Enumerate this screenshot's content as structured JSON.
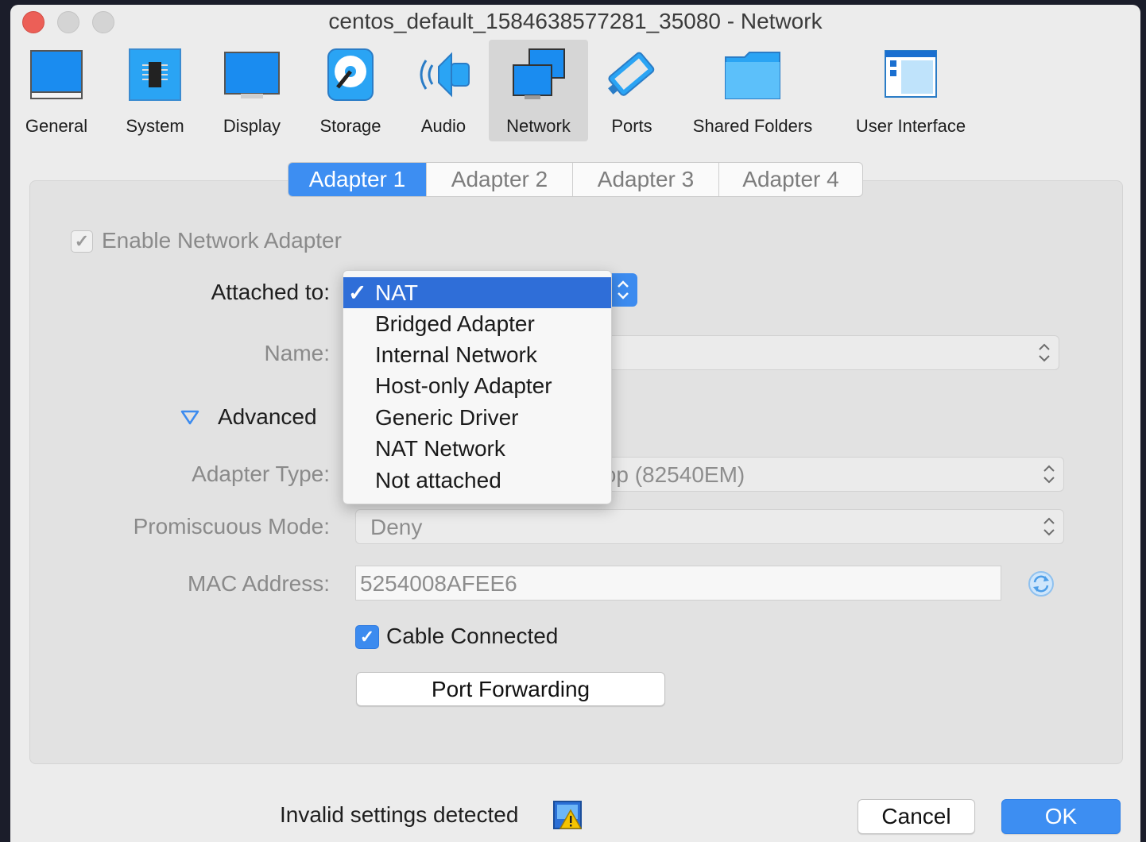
{
  "window": {
    "title": "centos_default_1584638577281_35080 - Network"
  },
  "toolbar": {
    "items": [
      {
        "label": "General",
        "icon": "general-icon"
      },
      {
        "label": "System",
        "icon": "chip-icon"
      },
      {
        "label": "Display",
        "icon": "monitor-icon"
      },
      {
        "label": "Storage",
        "icon": "disk-icon"
      },
      {
        "label": "Audio",
        "icon": "speaker-icon"
      },
      {
        "label": "Network",
        "icon": "network-icon"
      },
      {
        "label": "Ports",
        "icon": "serial-port-icon"
      },
      {
        "label": "Shared Folders",
        "icon": "folder-icon"
      },
      {
        "label": "User Interface",
        "icon": "user-interface-icon"
      }
    ],
    "active": "Network"
  },
  "tabs": {
    "items": [
      "Adapter 1",
      "Adapter 2",
      "Adapter 3",
      "Adapter 4"
    ],
    "active": "Adapter 1"
  },
  "adapter": {
    "enable_label": "Enable Network Adapter",
    "enabled": true,
    "attached_label": "Attached to:",
    "name_label": "Name:",
    "advanced_label": "Advanced",
    "adapter_type_label": "Adapter Type:",
    "adapter_type_value": "ktop (82540EM)",
    "promiscuous_label": "Promiscuous Mode:",
    "promiscuous_value": "Deny",
    "mac_label": "MAC Address:",
    "mac_value": "5254008AFEE6",
    "cable_label": "Cable Connected",
    "cable_connected": true,
    "port_forwarding_label": "Port Forwarding"
  },
  "dropdown": {
    "selected": "NAT",
    "check": "✓",
    "options": [
      "NAT",
      "Bridged Adapter",
      "Internal Network",
      "Host-only Adapter",
      "Generic Driver",
      "NAT Network",
      "Not attached"
    ]
  },
  "footer": {
    "status": "Invalid settings detected",
    "cancel_label": "Cancel",
    "ok_label": "OK"
  },
  "colors": {
    "accent": "#3d8ef2",
    "selection": "#2f6ed8",
    "warning": "#f5c400"
  }
}
